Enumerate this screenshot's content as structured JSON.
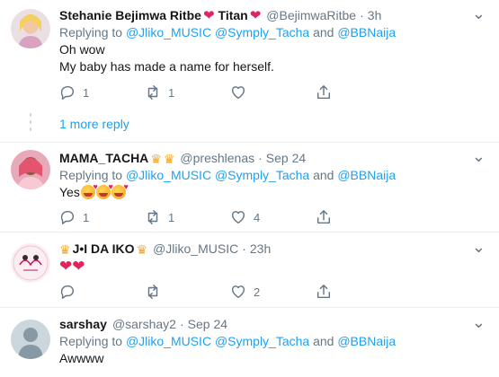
{
  "tweets": [
    {
      "name": "Stehanie Bejimwa Ritbe",
      "name2": "Titan",
      "handle": "@BejimwaRitbe",
      "time": "3h",
      "replying_prefix": "Replying to",
      "replying_handles": "@Jliko_MUSIC @Symply_Tacha",
      "replying_and": "and",
      "replying_last": "@BBNaija",
      "lines": [
        "Oh wow",
        "My baby has made a name for herself."
      ],
      "replies": "1",
      "retweets": "1",
      "likes": ""
    },
    {
      "name": "MAMA_TACHA",
      "handle": "@preshlenas",
      "time": "Sep 24",
      "replying_prefix": "Replying to",
      "replying_handles": "@Jliko_MUSIC @Symply_Tacha",
      "replying_and": "and",
      "replying_last": "@BBNaija",
      "text": "Yes",
      "replies": "1",
      "retweets": "1",
      "likes": "4"
    },
    {
      "name": "J•I DA IKO",
      "handle": "@Jliko_MUSIC",
      "time": "23h",
      "replies": "",
      "retweets": "",
      "likes": "2"
    },
    {
      "name": "sarshay",
      "handle": "@sarshay2",
      "time": "Sep 24",
      "replying_prefix": "Replying to",
      "replying_handles": "@Jliko_MUSIC @Symply_Tacha",
      "replying_and": "and",
      "replying_last": "@BBNaija",
      "text": "Awwww"
    }
  ],
  "thread": {
    "more_reply": "1 more reply"
  },
  "separator": "·",
  "icons": [
    "reply-icon",
    "retweet-icon",
    "like-icon",
    "share-icon",
    "more-icon"
  ],
  "colors": {
    "link": "#1da1f2",
    "muted": "#657786",
    "heart": "#e0245e"
  }
}
